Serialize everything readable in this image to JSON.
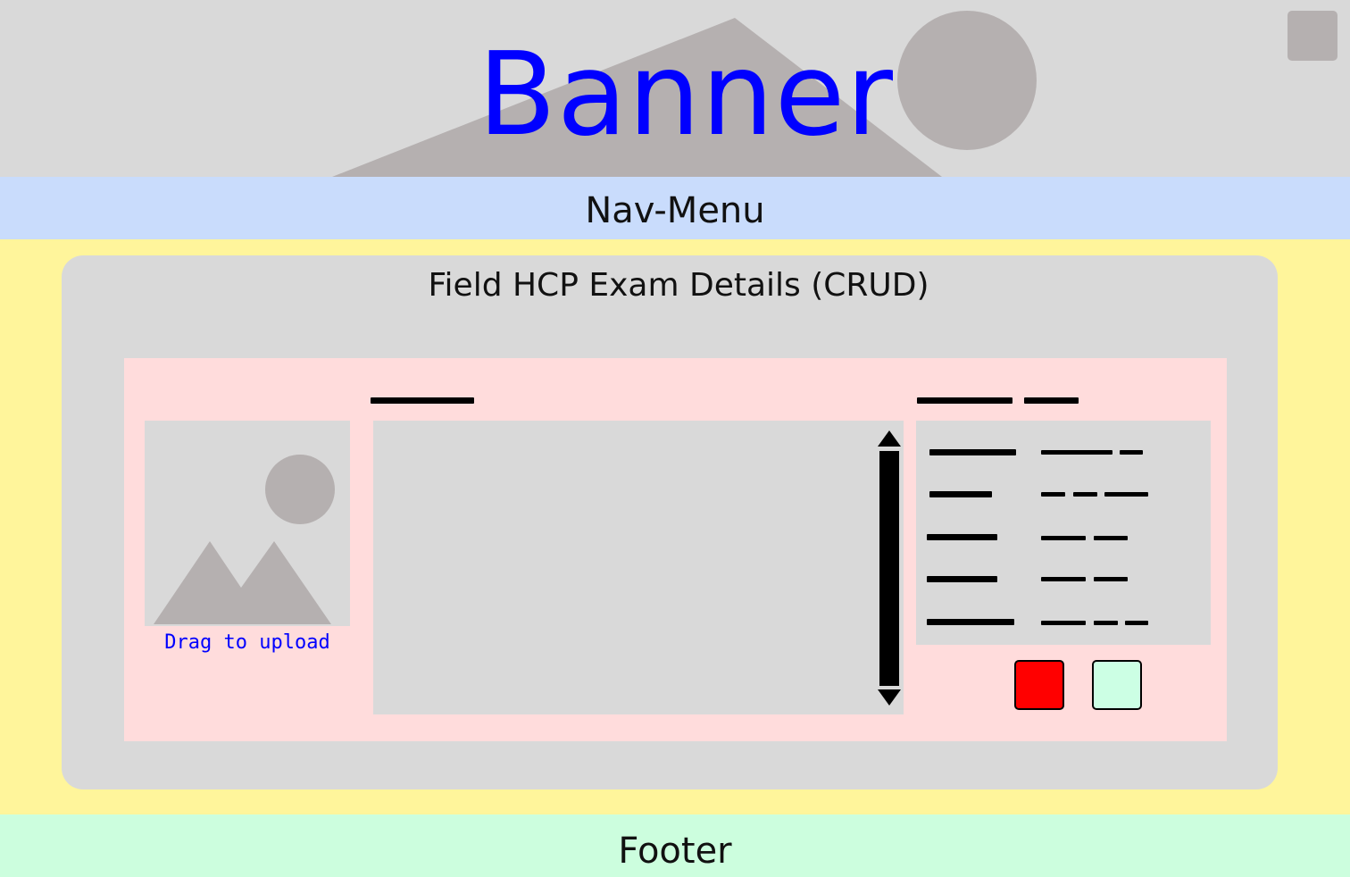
{
  "banner": {
    "title": "Banner",
    "title_color": "#0000ff",
    "background": "#d9d9d9",
    "decoration_icon": "image-placeholder-icon",
    "corner_button_icon": "square-button-icon"
  },
  "nav": {
    "label": "Nav-Menu",
    "background": "#c9dcfc"
  },
  "main": {
    "title": "Field HCP Exam Details (CRUD)",
    "background": "#fff59b",
    "card_background": "#d9d9d9",
    "panel_background": "#ffdcdc",
    "upload": {
      "icon": "image-placeholder-icon",
      "label": "Drag to upload",
      "label_color": "#0000ff"
    },
    "textarea": {
      "scroll_up_icon": "arrow-up-icon",
      "scroll_down_icon": "arrow-down-icon"
    },
    "details_rows": 5,
    "actions": {
      "delete_color": "#ff0000",
      "save_color": "#ccffe4"
    }
  },
  "footer": {
    "label": "Footer",
    "background": "#ccfede"
  }
}
